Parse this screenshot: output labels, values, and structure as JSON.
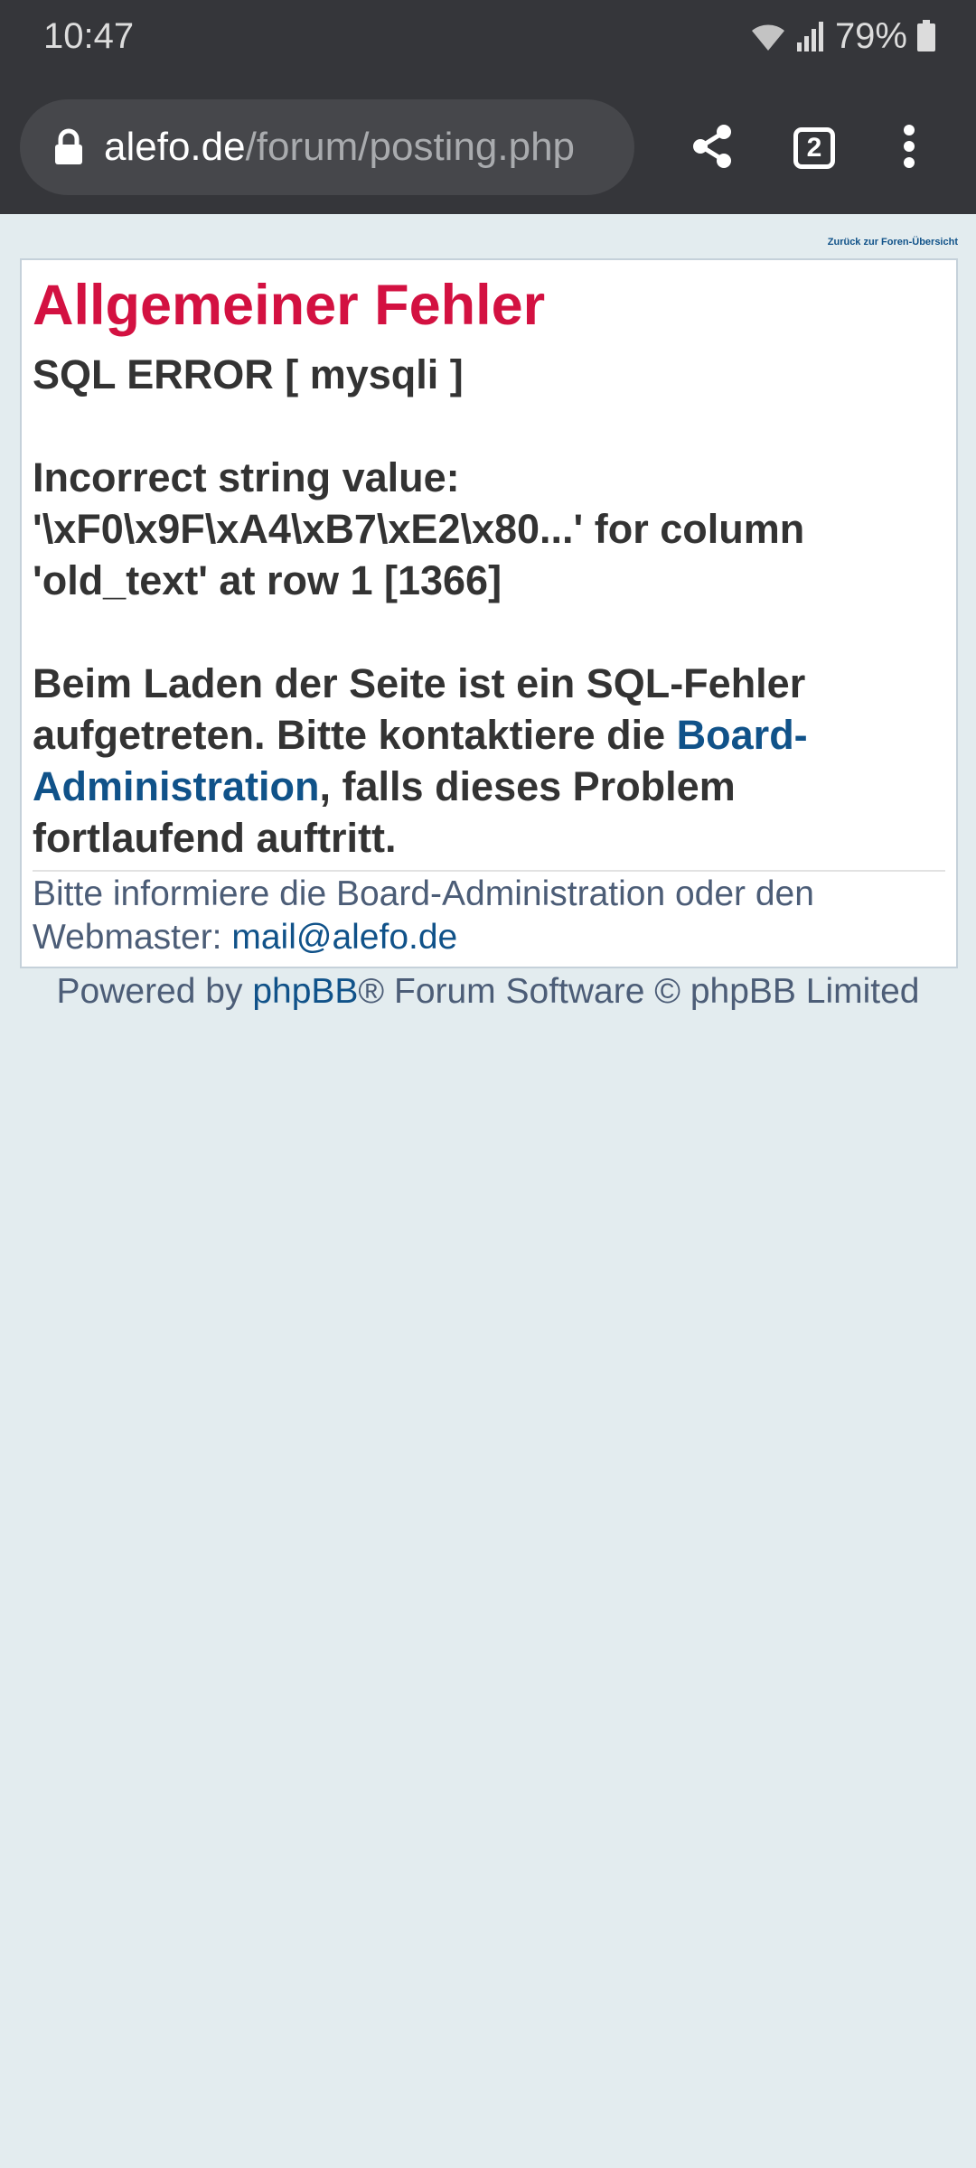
{
  "status_bar": {
    "time": "10:47",
    "battery": "79%"
  },
  "browser": {
    "url_domain": "alefo.de",
    "url_path": "/forum/posting.php",
    "tab_count": "2",
    "icons": [
      "lock-icon",
      "share-icon",
      "tabs-icon",
      "more-vert-icon",
      "wifi-icon",
      "signal-icon",
      "battery-icon"
    ]
  },
  "page": {
    "back_link": "Zurück zur Foren-Übersicht",
    "title": "Allgemeiner Fehler",
    "sql_error": "SQL ERROR [ mysqli ]",
    "error_line1": "Incorrect string value:",
    "error_line2": "'\\xF0\\x9F\\xA4\\xB7\\xE2\\x80...' for column",
    "error_line3": "'old_text' at row 1 [1366]",
    "message_pre": "Beim Laden der Seite ist ein SQL-Fehler aufgetreten. Bitte kontaktiere die ",
    "message_link_1": "Board-",
    "message_link_2": "Administration",
    "message_post": ", falls dieses Problem fortlaufend auftritt.",
    "notice_text_1": "Bitte informiere die Board-Administration oder den",
    "notice_text_2": "Webmaster: ",
    "notice_email": "mail@alefo.de"
  },
  "footer": {
    "prefix": "Powered by ",
    "link": "phpBB",
    "suffix": "® Forum Software © phpBB Limited"
  },
  "colors": {
    "chrome_bg": "#35363a",
    "page_bg": "#e3ecef",
    "title": "#d31141",
    "link": "#105289",
    "text": "#333333",
    "muted": "#4c5d77"
  }
}
